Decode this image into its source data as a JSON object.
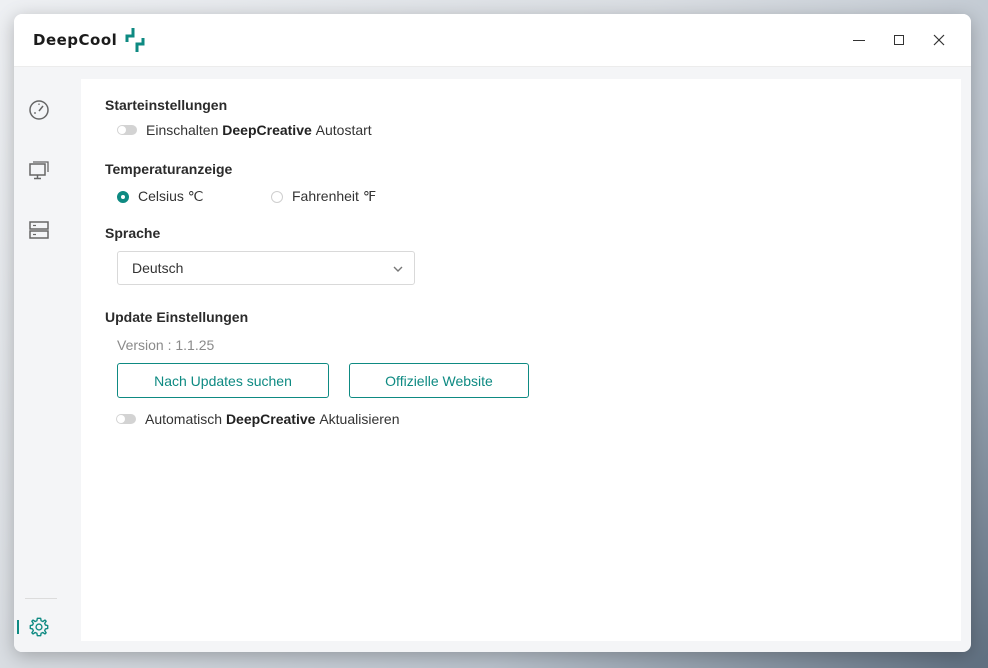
{
  "app": {
    "logo_text": "DeepCool"
  },
  "sidebar": {
    "items": [
      {
        "icon": "speedometer-icon"
      },
      {
        "icon": "monitor-icon"
      },
      {
        "icon": "storage-icon"
      },
      {
        "icon": "gear-icon",
        "active": true
      }
    ]
  },
  "settings": {
    "startup": {
      "heading": "Starteinstellungen",
      "toggle_prefix": "Einschalten",
      "toggle_brand": "DeepCreative",
      "toggle_suffix": "Autostart"
    },
    "temperature": {
      "heading": "Temperaturanzeige",
      "options": [
        "Celsius ℃",
        "Fahrenheit ℉"
      ],
      "selected": "Celsius ℃"
    },
    "language": {
      "heading": "Sprache",
      "selected": "Deutsch"
    },
    "update": {
      "heading": "Update Einstellungen",
      "version": "Version : 1.1.25",
      "check_button": "Nach Updates suchen",
      "website_button": "Offizielle Website",
      "toggle_prefix": "Automatisch",
      "toggle_brand": "DeepCreative",
      "toggle_suffix": "Aktualisieren"
    }
  },
  "colors": {
    "accent": "#0e8a82"
  }
}
